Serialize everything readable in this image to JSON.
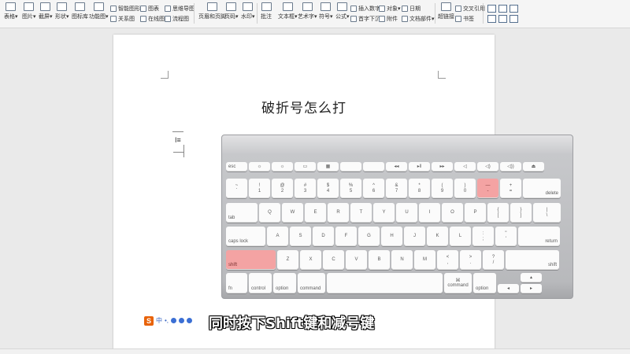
{
  "toolbar": {
    "items": [
      {
        "label": "表格▾"
      },
      {
        "label": "图片▾"
      },
      {
        "label": "截屏▾"
      },
      {
        "label": "形状▾"
      },
      {
        "label": "图标库"
      },
      {
        "label": "功能图▾"
      }
    ],
    "smart_shape": "智能图形",
    "chart": "图表",
    "mind_map": "思维导图",
    "relation_graph": "关系图",
    "online_chart": "在线图表",
    "flowchart": "流程图",
    "header_footer": "页眉和页脚",
    "page_number": "页码▾",
    "watermark": "水印▾",
    "comment": "批注",
    "text_box": "文本框▾",
    "art_text": "艺术字▾",
    "symbol": "符号▾",
    "formula": "公式▾",
    "insert_number": "插入数字",
    "first_letter_sink": "首字下沉",
    "object": "对象▾",
    "attachment": "附件",
    "date": "日期",
    "doc_parts": "文档部件▾",
    "hyperlink": "超链接",
    "cross_ref": "交叉引用",
    "bookmark": "书签"
  },
  "document": {
    "title": "破折号怎么打",
    "cursor_glyph": "I≡"
  },
  "keyboard": {
    "rows": [
      [
        "esc",
        "☼",
        "☼",
        "▭",
        "▦",
        "",
        "",
        "◂◂",
        "▸‖",
        "▸▸",
        "◁",
        "◁)",
        "◁))",
        "⏏"
      ],
      [
        "~\n`",
        "!\n1",
        "@\n2",
        "#\n3",
        "$\n4",
        "%\n5",
        "^\n6",
        "&\n7",
        "*\n8",
        "(\n9",
        ")\n0",
        "—\n-",
        "+\n=",
        "delete"
      ],
      [
        "tab",
        "Q",
        "W",
        "E",
        "R",
        "T",
        "Y",
        "U",
        "I",
        "O",
        "P",
        "{\n[",
        "}\n]",
        "|\n\\"
      ],
      [
        "caps lock",
        "A",
        "S",
        "D",
        "F",
        "G",
        "H",
        "J",
        "K",
        "L",
        ":\n;",
        "\"\n'",
        "return"
      ],
      [
        "shift",
        "Z",
        "X",
        "C",
        "V",
        "B",
        "N",
        "M",
        "<\n,",
        ">\n.",
        "?\n/",
        "shift"
      ],
      [
        "fn",
        "control",
        "option",
        "command",
        "",
        "⌘\ncommand",
        "option",
        "◂",
        "▴",
        "▾",
        "▸"
      ]
    ],
    "highlight_color": "#f4a3a3"
  },
  "ime": {
    "logo": "S",
    "mode": "中",
    "punct": "•,"
  },
  "subtitle": "同时按下Shift键和减号键"
}
